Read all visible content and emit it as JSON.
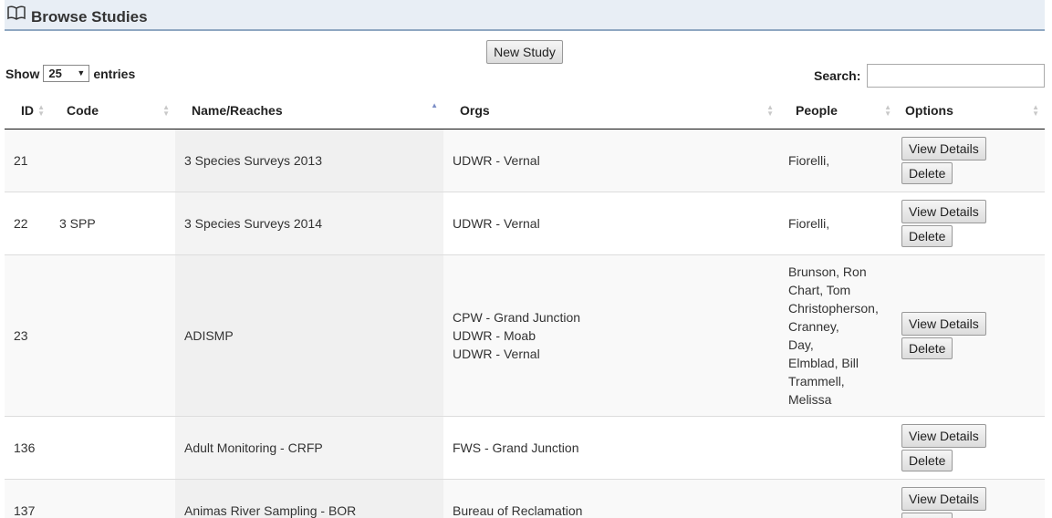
{
  "header": {
    "title": "Browse Studies",
    "icon": "book-icon"
  },
  "toolbar": {
    "new_study_label": "New Study"
  },
  "length": {
    "show_label": "Show",
    "value": "25",
    "entries_label": "entries"
  },
  "search": {
    "label": "Search:",
    "value": ""
  },
  "columns": [
    "ID",
    "Code",
    "Name/Reaches",
    "Orgs",
    "People",
    "Options"
  ],
  "buttons": {
    "view_details": "View Details",
    "delete": "Delete"
  },
  "rows": [
    {
      "id": "21",
      "code": "",
      "name": "3 Species Surveys 2013",
      "orgs": [
        "UDWR - Vernal"
      ],
      "people": [
        "Fiorelli,"
      ]
    },
    {
      "id": "22",
      "code": "3 SPP",
      "name": "3 Species Surveys 2014",
      "orgs": [
        "UDWR - Vernal"
      ],
      "people": [
        "Fiorelli,"
      ]
    },
    {
      "id": "23",
      "code": "",
      "name": "ADISMP",
      "orgs": [
        "CPW - Grand Junction",
        "UDWR - Moab",
        "UDWR - Vernal"
      ],
      "people": [
        "Brunson, Ron",
        "Chart, Tom",
        "Christopherson,",
        "Cranney,",
        "Day,",
        "Elmblad, Bill",
        "Trammell,",
        "Melissa"
      ]
    },
    {
      "id": "136",
      "code": "",
      "name": "Adult Monitoring - CRFP",
      "orgs": [
        "FWS - Grand Junction"
      ],
      "people": []
    },
    {
      "id": "137",
      "code": "",
      "name": "Animas River Sampling - BOR",
      "orgs": [
        "Bureau of Reclamation"
      ],
      "people": []
    }
  ]
}
